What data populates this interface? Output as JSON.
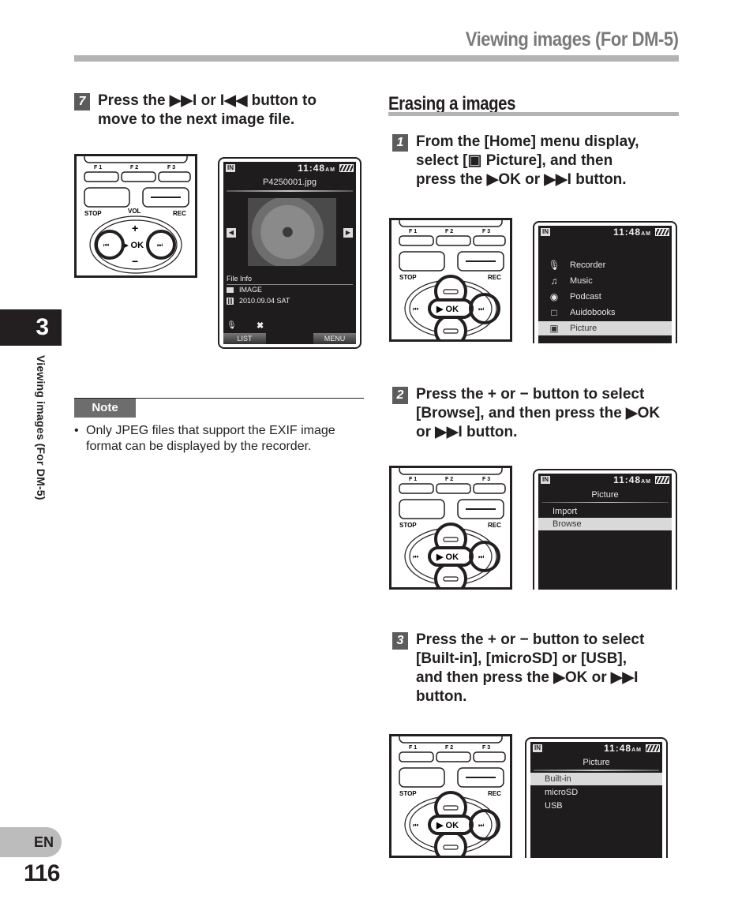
{
  "header": {
    "title": "Viewing images (For DM-5)"
  },
  "side": {
    "chapter": "3",
    "section_label": "Viewing images (For DM-5)",
    "lang": "EN",
    "page_number": "116"
  },
  "step7": {
    "number": "7",
    "line1": "Press the ▶▶I or I◀◀ button to",
    "line2": "move to the next image file."
  },
  "keypad": {
    "f1": "F 1",
    "f2": "F 2",
    "f3": "F 3",
    "stop": "STOP",
    "vol": "VOL",
    "rec": "REC",
    "ok": "▶ OK",
    "plus": "+",
    "minus": "−"
  },
  "viewer": {
    "storage": "IN",
    "time": "11:48",
    "ampm": "AM",
    "filename": "P4250001.jpg",
    "prev_icon": "◀",
    "next_icon": "▶",
    "file_info_label": "File Info",
    "folder": "IMAGE",
    "date": "2010.09.04 SAT",
    "softkey_left": "LIST",
    "softkey_right": "MENU"
  },
  "note": {
    "label": "Note",
    "bullet": "•",
    "text": "Only JPEG files that support the EXIF image format can be displayed by the recorder."
  },
  "section": {
    "title": "Erasing a images"
  },
  "step1": {
    "number": "1",
    "line1": "From the [Home] menu display,",
    "line2": "select [▣ Picture], and then",
    "line3": "press the ▶OK or ▶▶I button."
  },
  "home_menu": {
    "storage": "IN",
    "time": "11:48",
    "ampm": "AM",
    "items": [
      {
        "icon": "🎙",
        "label": "Recorder",
        "selected": false
      },
      {
        "icon": "♫",
        "label": "Music",
        "selected": false
      },
      {
        "icon": "◉",
        "label": "Podcast",
        "selected": false
      },
      {
        "icon": "□",
        "label": "Auidobooks",
        "selected": false
      },
      {
        "icon": "▣",
        "label": "Picture",
        "selected": true
      }
    ]
  },
  "step2": {
    "number": "2",
    "line1": "Press the + or − button to select",
    "line2": "[Browse], and then press the ▶OK",
    "line3": "or ▶▶I button."
  },
  "picture_menu": {
    "storage": "IN",
    "time": "11:48",
    "ampm": "AM",
    "title": "Picture",
    "items": [
      {
        "label": "Import",
        "selected": false
      },
      {
        "label": "Browse",
        "selected": true
      }
    ]
  },
  "step3": {
    "number": "3",
    "line1": "Press the + or − button to select",
    "line2": "[Built-in], [microSD] or [USB],",
    "line3": "and then press the ▶OK or ▶▶I",
    "line4": "button."
  },
  "storage_menu": {
    "storage": "IN",
    "time": "11:48",
    "ampm": "AM",
    "title": "Picture",
    "items": [
      {
        "label": "Built-in",
        "selected": true
      },
      {
        "label": "microSD",
        "selected": false
      },
      {
        "label": "USB",
        "selected": false
      }
    ]
  }
}
